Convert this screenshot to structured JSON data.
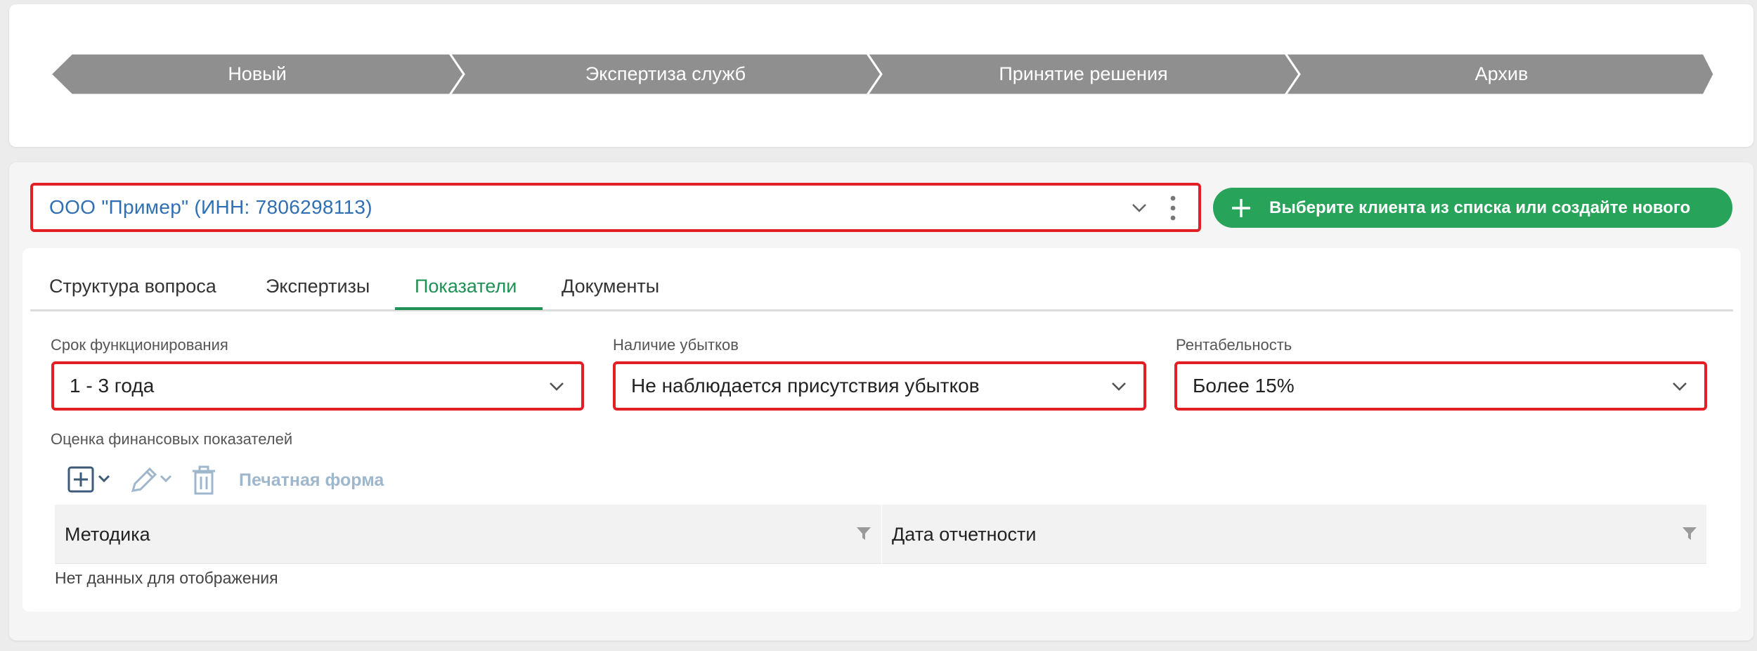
{
  "stages": [
    "Новый",
    "Экспертиза служб",
    "Принятие решения",
    "Архив"
  ],
  "client": {
    "value": "ООО \"Пример\" (ИНН: 7806298113)",
    "add_button_label": "Выберите клиента из списка или создайте нового"
  },
  "tabs": [
    {
      "label": "Структура вопроса",
      "active": false
    },
    {
      "label": "Экспертизы",
      "active": false
    },
    {
      "label": "Показатели",
      "active": true
    },
    {
      "label": "Документы",
      "active": false
    }
  ],
  "fields": {
    "lifetime": {
      "label": "Срок функционирования",
      "value": "1 - 3 года"
    },
    "losses": {
      "label": "Наличие убытков",
      "value": "Не наблюдается присутствия убытков"
    },
    "profitability": {
      "label": "Рентабельность",
      "value": "Более 15%"
    }
  },
  "financials": {
    "label": "Оценка финансовых показателей",
    "print_form": "Печатная форма",
    "columns": [
      "Методика",
      "Дата отчетности"
    ],
    "empty_text": "Нет данных для отображения"
  },
  "colors": {
    "stage": "#8f8f8f",
    "accent_green": "#27a35a",
    "active_tab": "#1f9154",
    "highlight_border": "#e31f26",
    "client_text": "#2f6fb3"
  }
}
